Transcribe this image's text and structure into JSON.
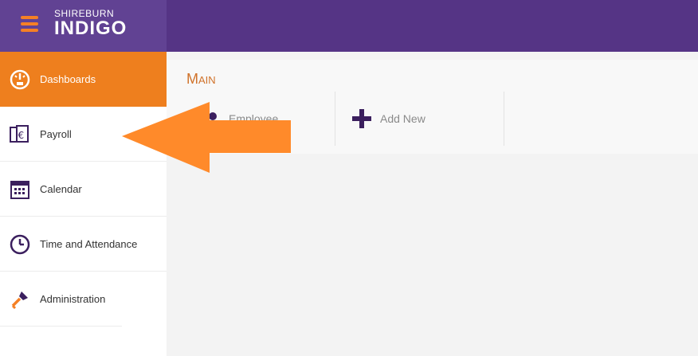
{
  "brand": {
    "line1": "SHIREBURN",
    "line2": "INDIGO"
  },
  "sidebar": {
    "items": [
      {
        "label": "Dashboards",
        "icon": "dashboard-gauge-icon",
        "active": true
      },
      {
        "label": "Payroll",
        "icon": "payroll-euro-icon"
      },
      {
        "label": "Calendar",
        "icon": "calendar-icon"
      },
      {
        "label": "Time and Attendance",
        "icon": "clock-icon"
      },
      {
        "label": "Administration",
        "icon": "key-icon"
      }
    ]
  },
  "main": {
    "title": "Main",
    "tiles": [
      {
        "label": "Employee",
        "icon": "employee-icon"
      },
      {
        "label": "Add New",
        "icon": "plus-icon"
      }
    ]
  },
  "colors": {
    "header": "#553485",
    "brand_bg": "#614293",
    "accent": "#ee7f1e",
    "icon": "#3b1f5e",
    "arrow": "#ff8a2a"
  }
}
